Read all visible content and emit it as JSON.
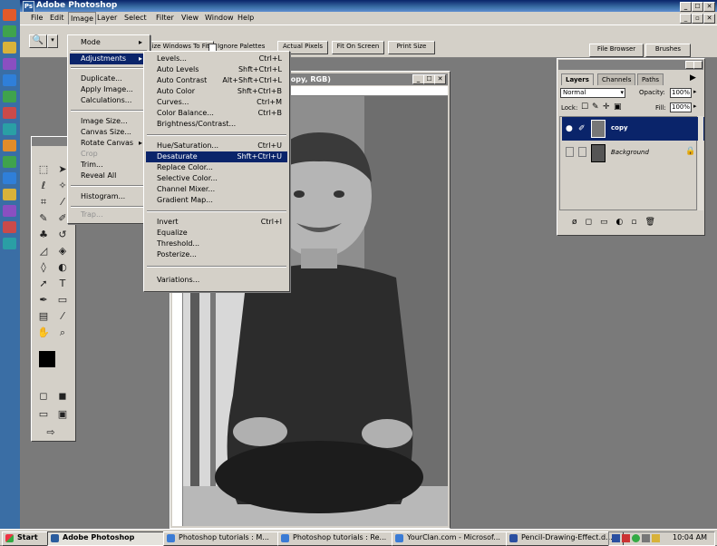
{
  "app": {
    "title": "Adobe Photoshop",
    "window_controls": [
      "_",
      "☐",
      "✕"
    ]
  },
  "menubar": [
    "File",
    "Edit",
    "Image",
    "Layer",
    "Select",
    "Filter",
    "View",
    "Window",
    "Help"
  ],
  "options_bar": {
    "buttons": [
      "Resize Windows To Fit",
      "Actual Pixels",
      "Fit On Screen",
      "Print Size"
    ],
    "checkbox_label": "Ignore Palettes",
    "palette_tabs": [
      "File Browser",
      "Brushes"
    ]
  },
  "document": {
    "title": "copy, RGB)"
  },
  "image_menu": {
    "items": [
      {
        "label": "Mode",
        "submenu": true
      },
      {
        "label": "Adjustments",
        "submenu": true,
        "selected": true
      },
      {
        "label": "Duplicate..."
      },
      {
        "label": "Apply Image..."
      },
      {
        "label": "Calculations..."
      },
      {
        "label": "Image Size..."
      },
      {
        "label": "Canvas Size..."
      },
      {
        "label": "Rotate Canvas",
        "submenu": true
      },
      {
        "label": "Crop",
        "disabled": true
      },
      {
        "label": "Trim..."
      },
      {
        "label": "Reveal All"
      },
      {
        "label": "Histogram..."
      },
      {
        "label": "Trap...",
        "disabled": true
      }
    ]
  },
  "adjustments_menu": {
    "items": [
      {
        "label": "Levels...",
        "shortcut": "Ctrl+L"
      },
      {
        "label": "Auto Levels",
        "shortcut": "Shft+Ctrl+L"
      },
      {
        "label": "Auto Contrast",
        "shortcut": "Alt+Shft+Ctrl+L"
      },
      {
        "label": "Auto Color",
        "shortcut": "Shft+Ctrl+B"
      },
      {
        "label": "Curves...",
        "shortcut": "Ctrl+M"
      },
      {
        "label": "Color Balance...",
        "shortcut": "Ctrl+B"
      },
      {
        "label": "Brightness/Contrast..."
      },
      {
        "label": "Hue/Saturation...",
        "shortcut": "Ctrl+U"
      },
      {
        "label": "Desaturate",
        "shortcut": "Shft+Ctrl+U",
        "selected": true
      },
      {
        "label": "Replace Color..."
      },
      {
        "label": "Selective Color..."
      },
      {
        "label": "Channel Mixer..."
      },
      {
        "label": "Gradient Map..."
      },
      {
        "label": "Invert",
        "shortcut": "Ctrl+I"
      },
      {
        "label": "Equalize"
      },
      {
        "label": "Threshold..."
      },
      {
        "label": "Posterize..."
      },
      {
        "label": "Variations..."
      }
    ]
  },
  "layers_palette": {
    "tabs": [
      "Layers",
      "Channels",
      "Paths"
    ],
    "blend_mode": "Normal",
    "opacity_label": "Opacity:",
    "opacity_value": "100%",
    "lock_label": "Lock:",
    "fill_label": "Fill:",
    "fill_value": "100%",
    "layers": [
      {
        "name": "copy",
        "selected": true
      },
      {
        "name": "Background",
        "selected": false
      }
    ]
  },
  "taskbar": {
    "start_label": "Start",
    "buttons": [
      {
        "label": "Adobe Photoshop",
        "active": true
      },
      {
        "label": "Photoshop tutorials : M..."
      },
      {
        "label": "Photoshop tutorials : Re..."
      },
      {
        "label": "YourClan.com - Microsof..."
      },
      {
        "label": "Pencil-Drawing-Effect.d..."
      }
    ],
    "clock": "10:04 AM"
  },
  "colors": {
    "selection": "#0a246a",
    "chrome": "#d4d0c8",
    "desktop_blue": "#3a6ea5"
  }
}
